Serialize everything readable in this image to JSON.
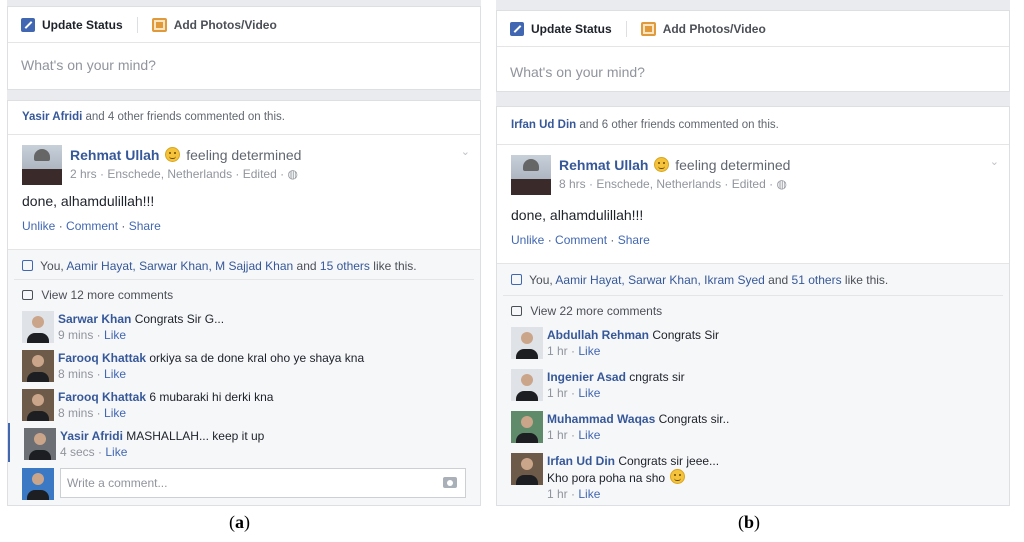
{
  "panel_a": {
    "composer": {
      "tab_status": "Update Status",
      "tab_photos": "Add Photos/Video",
      "placeholder": "What's on your mind?"
    },
    "post": {
      "social_name": "Yasir Afridi",
      "social_rest": "and 4 other friends commented on this.",
      "author": "Rehmat Ullah",
      "feeling": "feeling determined",
      "meta": "2 hrs · Enschede, Netherlands · Edited · ◍",
      "text": "done, alhamdulillah!!!",
      "actions": {
        "unlike": "Unlike",
        "comment": "Comment",
        "share": "Share"
      },
      "likes_prefix": "You,",
      "likes_names": "Aamir Hayat, Sarwar Khan, M Sajjad Khan",
      "likes_and": "and",
      "likes_others": "15 others",
      "likes_suffix": "like this.",
      "view_more": "View 12 more comments",
      "comments": [
        {
          "name": "Sarwar Khan",
          "text": "Congrats Sir G...",
          "time": "9 mins",
          "like": "Like"
        },
        {
          "name": "Farooq Khattak",
          "text": "orkiya sa de done kral oho ye shaya kna",
          "time": "8 mins",
          "like": "Like"
        },
        {
          "name": "Farooq Khattak",
          "text": "6 mubaraki hi derki kna",
          "time": "8 mins",
          "like": "Like"
        },
        {
          "name": "Yasir Afridi",
          "text": "MASHALLAH... keep it up",
          "time": "4 secs",
          "like": "Like"
        }
      ],
      "write_placeholder": "Write a comment..."
    }
  },
  "panel_b": {
    "composer": {
      "tab_status": "Update Status",
      "tab_photos": "Add Photos/Video",
      "placeholder": "What's on your mind?"
    },
    "post": {
      "social_name": "Irfan Ud Din",
      "social_rest": "and 6 other friends commented on this.",
      "author": "Rehmat Ullah",
      "feeling": "feeling determined",
      "meta": "8 hrs · Enschede, Netherlands · Edited · ◍",
      "text": "done, alhamdulillah!!!",
      "actions": {
        "unlike": "Unlike",
        "comment": "Comment",
        "share": "Share"
      },
      "likes_prefix": "You,",
      "likes_names": "Aamir Hayat, Sarwar Khan, Ikram Syed",
      "likes_and": "and",
      "likes_others": "51 others",
      "likes_suffix": "like this.",
      "view_more": "View 22 more comments",
      "comments": [
        {
          "name": "Abdullah Rehman",
          "text": "Congrats Sir",
          "time": "1 hr",
          "like": "Like"
        },
        {
          "name": "Ingenier Asad",
          "text": "cngrats sir",
          "time": "1 hr",
          "like": "Like"
        },
        {
          "name": "Muhammad Waqas",
          "text": "Congrats sir..",
          "time": "1 hr",
          "like": "Like"
        },
        {
          "name": "Irfan Ud Din",
          "text": "Congrats sir jeee...",
          "text2": "Kho pora poha na sho",
          "time": "1 hr",
          "like": "Like"
        }
      ]
    }
  },
  "captions": {
    "a": "a",
    "b": "b"
  },
  "colors": {
    "link": "#365899",
    "accent": "#4267b2",
    "muted": "#90949c",
    "background": "#e9ebee"
  }
}
